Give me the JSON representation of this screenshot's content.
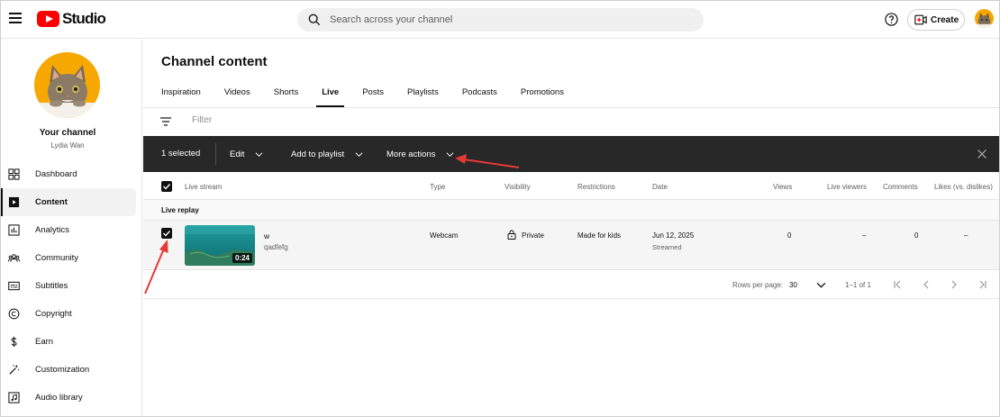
{
  "header": {
    "logo_text": "Studio",
    "search_placeholder": "Search across your channel",
    "create_label": "Create"
  },
  "sidebar": {
    "channel_name": "Your channel",
    "channel_user": "Lydia Wan",
    "items": [
      {
        "label": "Dashboard",
        "icon": "dashboard-icon"
      },
      {
        "label": "Content",
        "icon": "content-icon",
        "active": true
      },
      {
        "label": "Analytics",
        "icon": "analytics-icon"
      },
      {
        "label": "Community",
        "icon": "community-icon"
      },
      {
        "label": "Subtitles",
        "icon": "subtitles-icon"
      },
      {
        "label": "Copyright",
        "icon": "copyright-icon"
      },
      {
        "label": "Earn",
        "icon": "earn-icon"
      },
      {
        "label": "Customization",
        "icon": "customization-icon"
      },
      {
        "label": "Audio library",
        "icon": "audio-library-icon"
      }
    ]
  },
  "main": {
    "title": "Channel content",
    "tabs": [
      "Inspiration",
      "Videos",
      "Shorts",
      "Live",
      "Posts",
      "Playlists",
      "Podcasts",
      "Promotions"
    ],
    "active_tab": "Live",
    "filter_placeholder": "Filter"
  },
  "actionbar": {
    "selected": "1 selected",
    "edit": "Edit",
    "add_to_playlist": "Add to playlist",
    "more_actions": "More actions"
  },
  "table": {
    "columns": {
      "stream": "Live stream",
      "type": "Type",
      "visibility": "Visibility",
      "restrictions": "Restrictions",
      "date": "Date",
      "views": "Views",
      "live_viewers": "Live viewers",
      "comments": "Comments",
      "likes": "Likes (vs. dislikes)"
    },
    "group_label": "Live replay",
    "rows": [
      {
        "title": "w",
        "description": "qadfefg",
        "duration": "0:24",
        "type": "Webcam",
        "visibility": "Private",
        "restrictions": "Made for kids",
        "date": "Jun 12, 2025",
        "date_sub": "Streamed",
        "views": "0",
        "live_viewers": "–",
        "comments": "0",
        "likes": "–",
        "checked": true
      }
    ]
  },
  "pager": {
    "rows_label": "Rows per page:",
    "rows_value": "30",
    "range": "1–1 of 1"
  },
  "colors": {
    "accent": "#ff0000",
    "actionbar_bg": "#282828",
    "annotation_arrow": "#e53935",
    "avatar_bg": "#f6a800"
  }
}
